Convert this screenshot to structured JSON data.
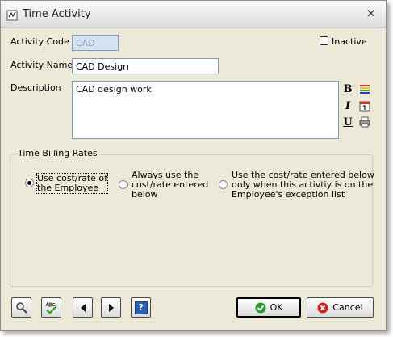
{
  "window": {
    "title": "Time Activity",
    "close_symbol": "×"
  },
  "form": {
    "activity_code": {
      "label": "Activity Code",
      "value": "CAD"
    },
    "inactive": {
      "label": "Inactive",
      "checked": false
    },
    "activity_name": {
      "label": "Activity Name",
      "value": "CAD Design"
    },
    "description": {
      "label": "Description",
      "value": "CAD design work"
    },
    "format_tools": {
      "bold": "B",
      "italic": "I",
      "underline": "U"
    }
  },
  "billing": {
    "group_label": "Time Billing Rates",
    "options": [
      {
        "line1": "Use cost/rate of",
        "line2": "the Employee",
        "line3": "",
        "selected": true
      },
      {
        "line1": "Always use the",
        "line2": "cost/rate entered",
        "line3": "below",
        "selected": false
      },
      {
        "line1": "Use the cost/rate entered below",
        "line2": "only when this activtiy is on the",
        "line3": "Employee's exception list",
        "selected": false
      }
    ]
  },
  "footer": {
    "ok_label": "OK",
    "cancel_label": "Cancel",
    "help_glyph": "?"
  },
  "colors": {
    "window_bg": "#ece9d8",
    "ok_green": "#2e9b2e",
    "cancel_red": "#cc2222",
    "help_blue": "#2c5fb3"
  }
}
